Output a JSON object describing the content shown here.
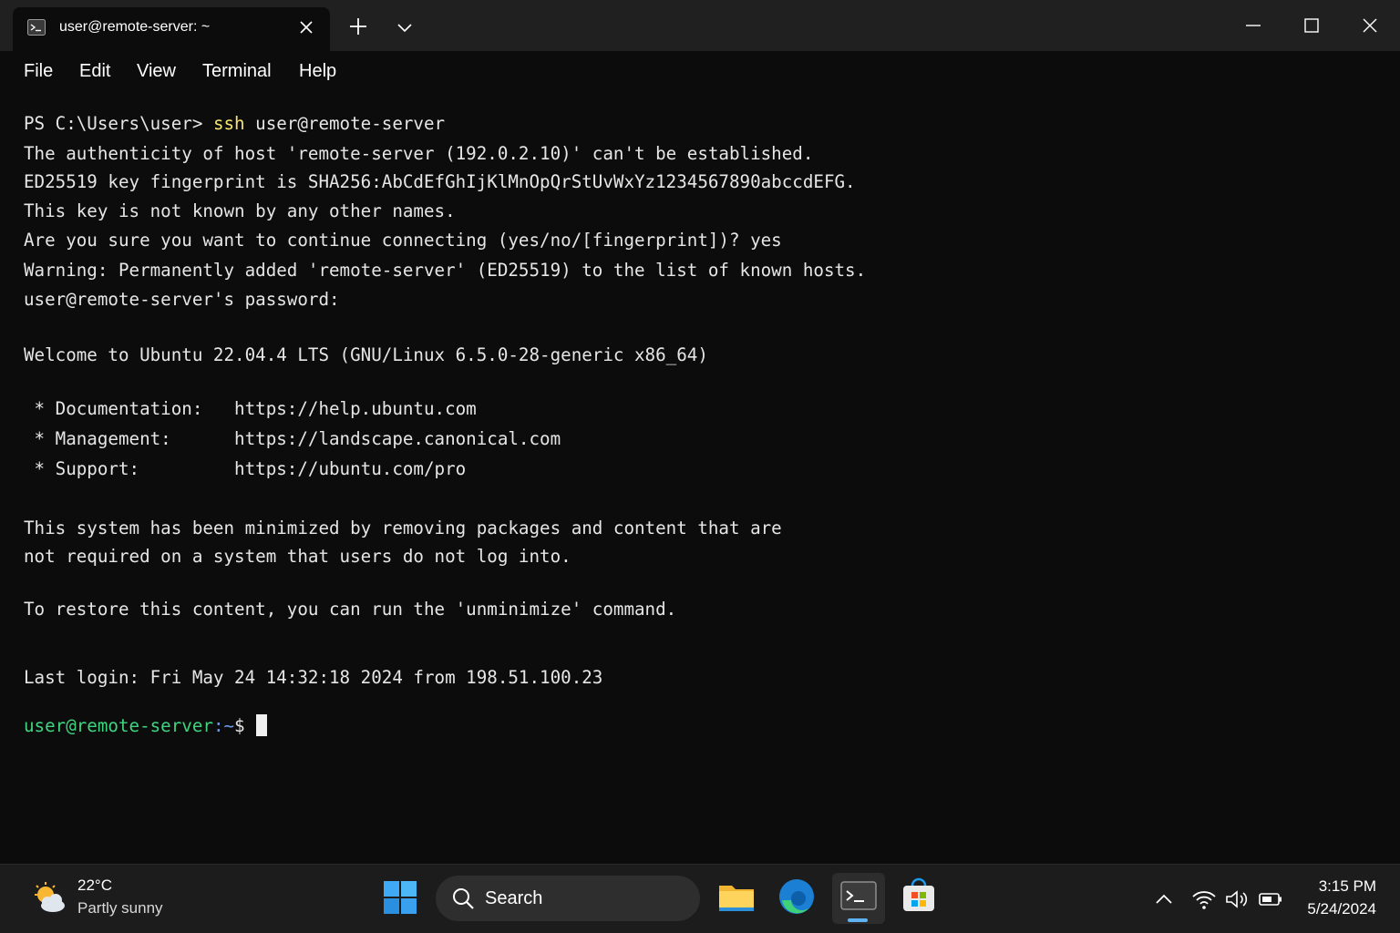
{
  "window": {
    "tab_title": "user@remote-server: ~",
    "menu": [
      "File",
      "Edit",
      "View",
      "Terminal",
      "Help"
    ]
  },
  "terminal": {
    "prompt_ps": "PS C:\\Users\\user> ",
    "cmd_ssh": "ssh",
    "cmd_args": " user@remote-server",
    "lines": [
      "The authenticity of host 'remote-server (192.0.2.10)' can't be established.",
      "ED25519 key fingerprint is SHA256:AbCdEfGhIjKlMnOpQrStUvWxYz1234567890abccdEFG.",
      "This key is not known by any other names.",
      "Are you sure you want to continue connecting (yes/no/[fingerprint])? yes",
      "Warning: Permanently added 'remote-server' (ED25519) to the list of known hosts.",
      "user@remote-server's password:",
      "Welcome to Ubuntu 22.04.4 LTS (GNU/Linux 6.5.0-28-generic x86_64)",
      " * Documentation:   https://help.ubuntu.com",
      " * Management:      https://landscape.canonical.com",
      " * Support:         https://ubuntu.com/pro",
      "This system has been minimized by removing packages and content that are",
      "not required on a system that users do not log into.",
      "To restore this content, you can run the 'unminimize' command.",
      "Last login: Fri May 24 14:32:18 2024 from 198.51.100.23"
    ],
    "final_prompt_user": "user@remote-server",
    "final_prompt_path": ":~",
    "final_prompt_symbol": "$"
  },
  "taskbar": {
    "weather_temp": "22°C",
    "weather_desc": "Partly sunny",
    "search_label": "Search",
    "time": "3:15 PM",
    "date": "5/24/2024"
  },
  "colors": {
    "prompt_green": "#3fd47e",
    "command_yellow": "#f4e66f",
    "accent": "#5fb2f2"
  }
}
